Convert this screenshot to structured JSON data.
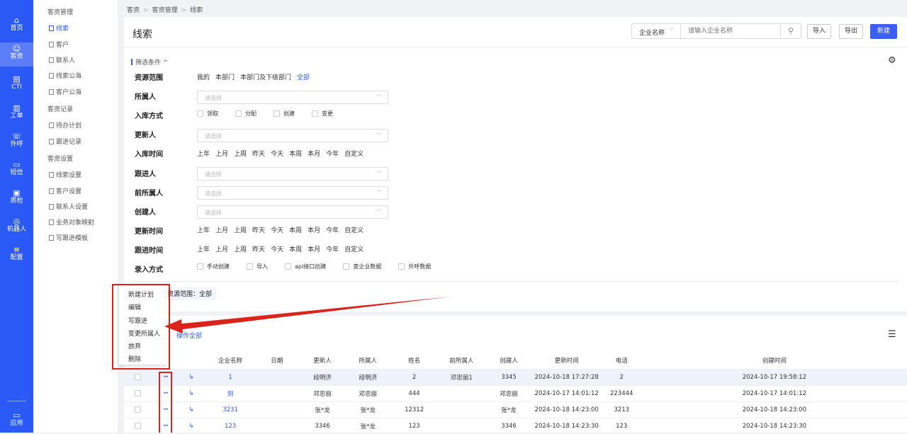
{
  "rail": {
    "items": [
      {
        "label": "首页",
        "icon": "home-icon",
        "glyph": "⌂"
      },
      {
        "label": "客资",
        "icon": "users-icon",
        "glyph": "☺"
      },
      {
        "label": "CTI",
        "icon": "cti-icon",
        "glyph": "▤"
      },
      {
        "label": "工单",
        "icon": "ticket-icon",
        "glyph": "▥"
      },
      {
        "label": "外呼",
        "icon": "phone-icon",
        "glyph": "☏"
      },
      {
        "label": "短信",
        "icon": "sms-icon",
        "glyph": "▭"
      },
      {
        "label": "质检",
        "icon": "inspect-icon",
        "glyph": "▣"
      },
      {
        "label": "机器人",
        "icon": "robot-icon",
        "glyph": "◎"
      },
      {
        "label": "配置",
        "icon": "config-icon",
        "glyph": "≡"
      }
    ],
    "bottom": {
      "label": "应用",
      "icon": "apps-icon",
      "glyph": "▭"
    }
  },
  "sidebar": {
    "groups": [
      {
        "title": "客资管理",
        "items": [
          "线索",
          "客户",
          "联系人",
          "线索公海",
          "客户公海"
        ]
      },
      {
        "title": "客资记录",
        "items": [
          "待办计划",
          "跟进记录"
        ]
      },
      {
        "title": "客资设置",
        "items": [
          "线索设置",
          "客户设置",
          "联系人设置",
          "业务对象映射",
          "写跟进模板"
        ]
      }
    ]
  },
  "breadcrumb": [
    "客资",
    "客资管理",
    "线索"
  ],
  "header": {
    "title": "线索",
    "search_type": "企业名称",
    "search_placeholder": "请输入企业名称",
    "import_label": "导入",
    "export_label": "导出",
    "new_label": "新建"
  },
  "filters": {
    "toggle_label": "筛选条件 ^",
    "resource_scope": {
      "label": "资源范围",
      "options": [
        "我的",
        "本部门",
        "本部门及下级部门",
        "全部"
      ],
      "selected": "全部"
    },
    "owner": {
      "label": "所属人",
      "placeholder": "请选择"
    },
    "storage_method": {
      "label": "入库方式",
      "options": [
        "领取",
        "分配",
        "创建",
        "变更"
      ]
    },
    "updater": {
      "label": "更新人",
      "placeholder": "请选择"
    },
    "storage_time": {
      "label": "入库时间",
      "options": [
        "上年",
        "上月",
        "上周",
        "昨天",
        "今天",
        "本周",
        "本月",
        "今年",
        "自定义"
      ]
    },
    "follower": {
      "label": "跟进人",
      "placeholder": "请选择"
    },
    "prev_owner": {
      "label": "前所属人",
      "placeholder": "请选择"
    },
    "creator": {
      "label": "创建人",
      "placeholder": "请选择"
    },
    "update_time": {
      "label": "更新时间",
      "options": [
        "上年",
        "上月",
        "上周",
        "昨天",
        "今天",
        "本周",
        "本月",
        "今年",
        "自定义"
      ]
    },
    "follow_time": {
      "label": "跟进时间",
      "options": [
        "上年",
        "上月",
        "上周",
        "昨天",
        "今天",
        "本周",
        "本月",
        "今年",
        "自定义"
      ]
    },
    "entry_method": {
      "label": "录入方式",
      "options": [
        "手动创建",
        "导入",
        "api接口创建",
        "查企业数据",
        "外呼数据"
      ]
    },
    "scope_tag": "资源范围：全部"
  },
  "context_menu": [
    "新建计划",
    "编辑",
    "写跟进",
    "变更所属人",
    "放弃",
    "删除"
  ],
  "list": {
    "op_all_label": "操作全部",
    "columns": [
      "企业名称",
      "日期",
      "更新人",
      "所属人",
      "姓名",
      "前所属人",
      "创建人",
      "更新时间",
      "电话",
      "创建时间"
    ],
    "rows": [
      [
        "1",
        "",
        "段明济",
        "段明济",
        "2",
        "邓忠丽1",
        "3345",
        "2024-10-18 17:27:28",
        "2",
        "2024-10-17 19:58:12"
      ],
      [
        "测",
        "",
        "邓忠丽",
        "邓忠丽",
        "444",
        "",
        "邓忠丽",
        "2024-10-17 14:01:12",
        "223444",
        "2024-10-17 14:01:12"
      ],
      [
        "3231",
        "",
        "张*龙",
        "张*龙",
        "12312",
        "",
        "张*龙",
        "2024-10-18 14:23:00",
        "3213",
        "2024-10-18 14:23:00"
      ],
      [
        "123",
        "",
        "3346",
        "张*龙",
        "123",
        "",
        "3346",
        "2024-10-18 14:23:30",
        "123",
        "2024-10-18 14:23:30"
      ]
    ]
  }
}
